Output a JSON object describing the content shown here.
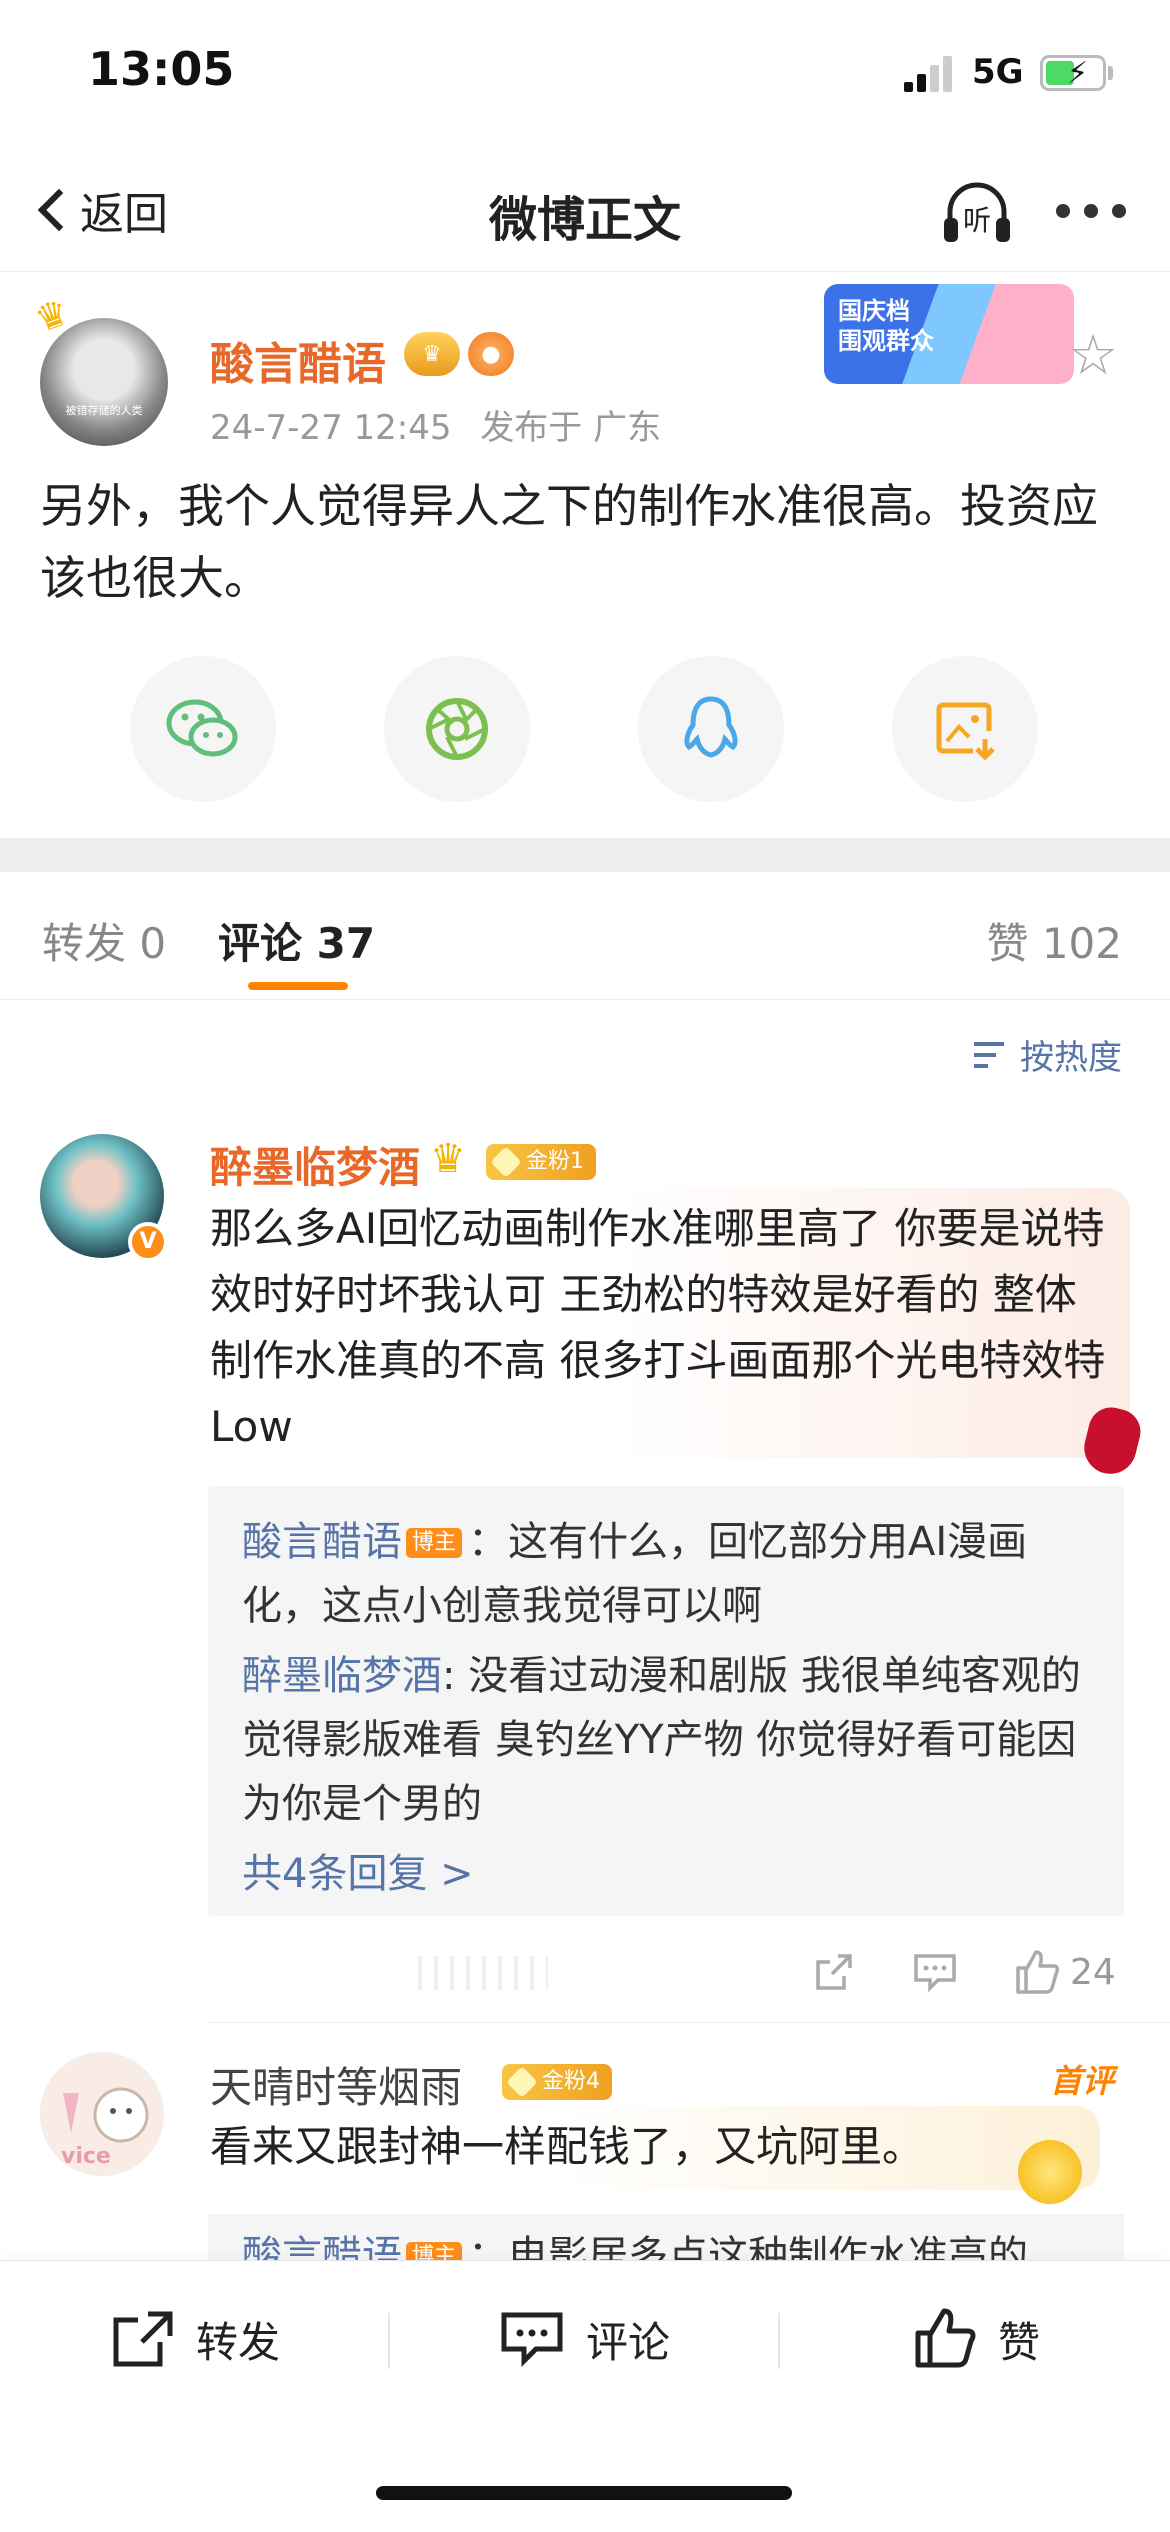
{
  "status_bar": {
    "time": "13:05",
    "network": "5G"
  },
  "nav": {
    "back_label": "返回",
    "title": "微博正文",
    "listen_icon_text": "听"
  },
  "post": {
    "author": "酸言醋语",
    "avatar_caption": "被错存储的人类",
    "time": "24-7-27 12:45",
    "location": "发布于 广东",
    "promo_line1": "国庆档",
    "promo_line2": "围观群众",
    "text": "另外，我个人觉得异人之下的制作水准很高。投资应该也很大。"
  },
  "share": [
    "wechat-icon",
    "moments-icon",
    "qq-icon",
    "save-image-icon"
  ],
  "tabs": {
    "repost_label": "转发",
    "repost_count": "0",
    "comment_label": "评论",
    "comment_count": "37",
    "like_label": "赞",
    "like_count": "102"
  },
  "sort_label": "按热度",
  "comments": [
    {
      "name": "醉墨临梦酒",
      "fan_badge": "金粉1",
      "verified": "V",
      "text": "那么多AI回忆动画制作水准哪里高了 你要是说特效时好时坏我认可 王劲松的特效是好看的 整体制作水准真的不高 很多打斗画面那个光电特效特 Low",
      "replies": [
        {
          "author": "酸言醋语",
          "tag": "博主",
          "text": "：这有什么，回忆部分用AI漫画化，这点小创意我觉得可以啊"
        },
        {
          "author": "醉墨临梦酒",
          "tag": "",
          "text": ": 没看过动漫和剧版 我很单纯客观的觉得影版难看 臭钓丝YY产物 你觉得好看可能因为你是个男的"
        }
      ],
      "more_replies": "共4条回复 >",
      "likes": "24"
    },
    {
      "name": "天晴时等烟雨_",
      "fan_badge": "金粉4",
      "first_tag": "首评",
      "text": "看来又跟封神一样配钱了，又坑阿里。",
      "reply_peek_author": "酸言醋语",
      "reply_peek_tag": "博主",
      "reply_peek_text": "：电影居多点这种制作水准高的"
    }
  ],
  "bottom_bar": {
    "repost": "转发",
    "comment": "评论",
    "like": "赞"
  },
  "colors": {
    "accent_orange": "#ff8200",
    "name_orange": "#e8682a",
    "link_blue": "#5774a8"
  }
}
